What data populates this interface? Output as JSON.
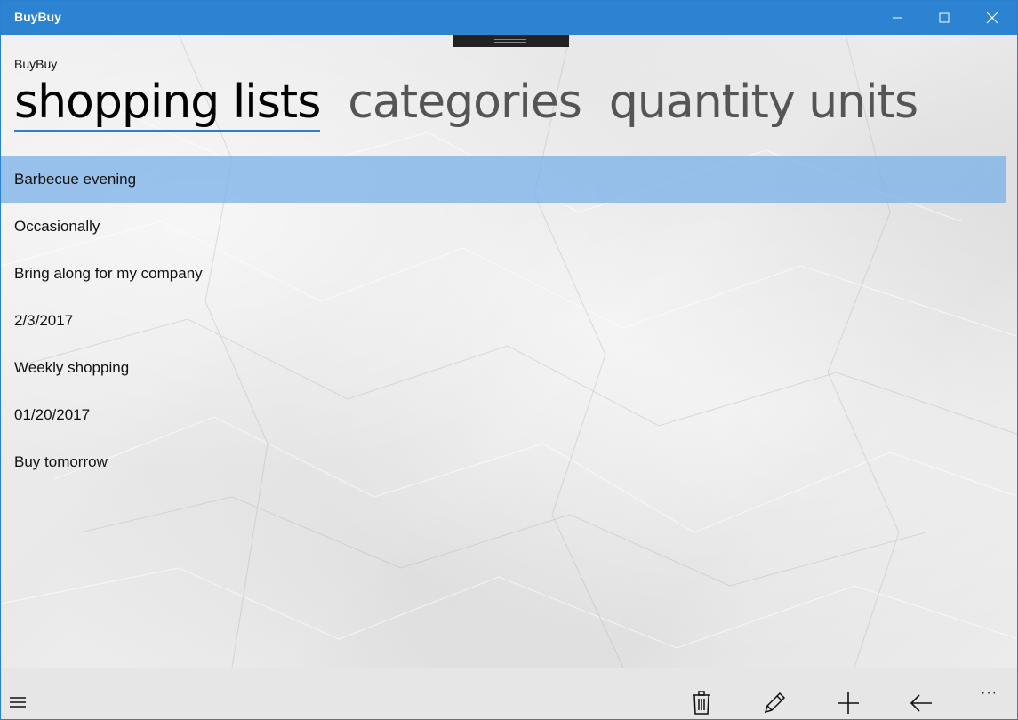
{
  "window": {
    "title": "BuyBuy"
  },
  "app": {
    "name": "BuyBuy"
  },
  "pivot": {
    "tabs": [
      {
        "label": "shopping lists",
        "active": true
      },
      {
        "label": "categories",
        "active": false
      },
      {
        "label": "quantity units",
        "active": false
      }
    ]
  },
  "lists": {
    "items": [
      {
        "label": "Barbecue evening",
        "selected": true
      },
      {
        "label": "Occasionally",
        "selected": false
      },
      {
        "label": "Bring along for my company",
        "selected": false
      },
      {
        "label": "2/3/2017",
        "selected": false
      },
      {
        "label": "Weekly shopping",
        "selected": false
      },
      {
        "label": "01/20/2017",
        "selected": false
      },
      {
        "label": "Buy tomorrow",
        "selected": false
      }
    ]
  },
  "appbar": {
    "buttons": [
      "trash-icon",
      "pencil-icon",
      "plus-icon",
      "arrow-left-icon"
    ],
    "more": "···"
  },
  "colors": {
    "titlebar": "#2b83d1",
    "accent": "#2b7fcf",
    "selection": "#78b0e8"
  }
}
